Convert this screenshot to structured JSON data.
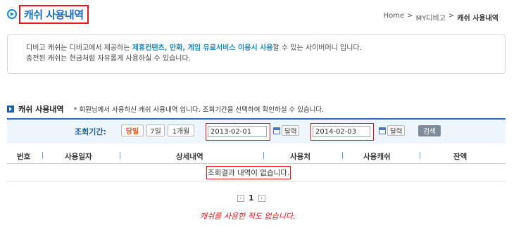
{
  "header": {
    "title": "캐쉬 사용내역",
    "breadcrumb": [
      "Home",
      ">",
      "MY디비고",
      ">",
      "캐쉬 사용내역"
    ]
  },
  "info": {
    "line1_pre": "디비고 캐쉬는 디비고에서 제공하는 ",
    "line1_hl": "제휴컨텐츠, 만화, 게임 유료서비스 이용시 사용",
    "line1_post": "할 수 있는 사이버머니 입니다.",
    "line2": "충전된 캐쉬는 현금처럼 자유롭게 사용하실 수 있습니다."
  },
  "section": {
    "title": "캐쉬 사용내역",
    "desc": "* 회원님께서 사용하신 캐쉬 사용내역 입니다. 조회기간을 선택하여 확인하실 수 있습니다."
  },
  "search": {
    "label": "조회기간:",
    "periods": [
      "당일",
      "7일",
      "1개월"
    ],
    "start_date": "2013-02-01",
    "end_date": "2014-02-03",
    "calendar_label": "달력",
    "tilde": "~",
    "search_button": "검색"
  },
  "table": {
    "columns": [
      "번호",
      "사용일자",
      "상세내역",
      "사용처",
      "사용캐쉬",
      "잔액"
    ],
    "empty_message": "조회결과 내역이 없습니다."
  },
  "pager": {
    "prev": "‹",
    "page": "1",
    "next": "›"
  },
  "note": "캐쉬를 사용한 적도 없습니다.",
  "colors": {
    "accent": "#1a6fbf",
    "annotation": "#e8141c"
  },
  "icons": [
    "play-circle-icon",
    "section-arrow-icon",
    "calendar-icon",
    "prev-page-icon",
    "next-page-icon"
  ]
}
